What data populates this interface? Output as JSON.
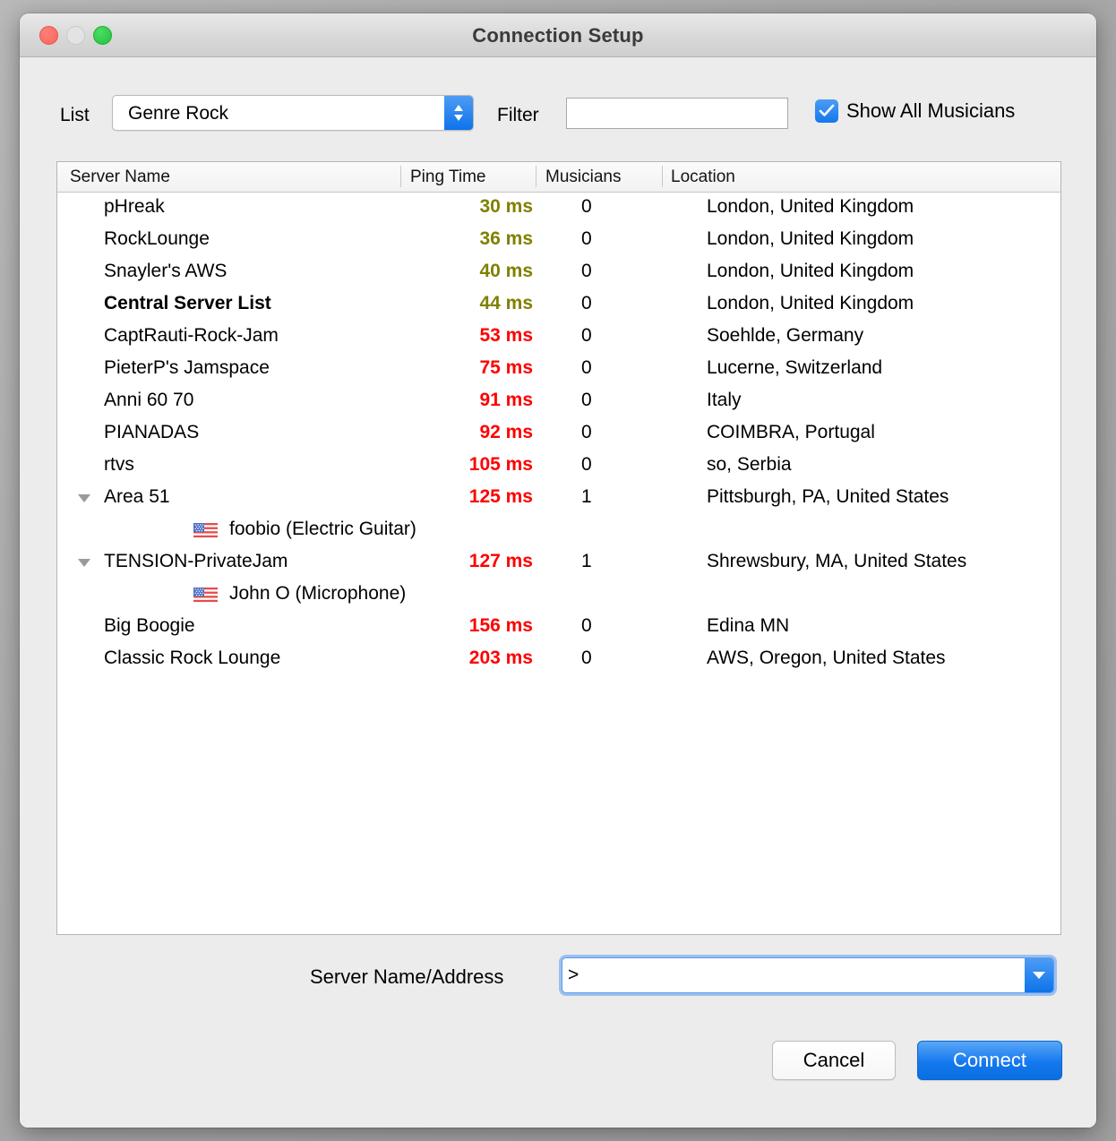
{
  "window": {
    "title": "Connection Setup",
    "traffic_lights": {
      "close": "close-button",
      "minimize": "minimize-button",
      "zoom": "zoom-button"
    }
  },
  "toolbar": {
    "list_label": "List",
    "list_value": "Genre Rock",
    "list_options": [
      "Genre Rock"
    ],
    "filter_label": "Filter",
    "filter_value": "",
    "filter_placeholder": "",
    "show_all_label": "Show All Musicians",
    "show_all_checked": true
  },
  "table": {
    "columns": [
      "Server Name",
      "Ping Time",
      "Musicians",
      "Location"
    ],
    "rows": [
      {
        "type": "server",
        "name": "pHreak",
        "ping": "30 ms",
        "ping_class": "olive",
        "musicians": "0",
        "location": "London, United Kingdom",
        "bold": false,
        "expandable": false
      },
      {
        "type": "server",
        "name": "RockLounge",
        "ping": "36 ms",
        "ping_class": "olive",
        "musicians": "0",
        "location": "London, United Kingdom",
        "bold": false,
        "expandable": false
      },
      {
        "type": "server",
        "name": "Snayler's AWS",
        "ping": "40 ms",
        "ping_class": "olive",
        "musicians": "0",
        "location": "London, United Kingdom",
        "bold": false,
        "expandable": false
      },
      {
        "type": "server",
        "name": "Central Server List",
        "ping": "44 ms",
        "ping_class": "olive",
        "musicians": "0",
        "location": "London, United Kingdom",
        "bold": true,
        "expandable": false
      },
      {
        "type": "server",
        "name": "CaptRauti-Rock-Jam",
        "ping": "53 ms",
        "ping_class": "red",
        "musicians": "0",
        "location": "Soehlde, Germany",
        "bold": false,
        "expandable": false
      },
      {
        "type": "server",
        "name": "PieterP's Jamspace",
        "ping": "75 ms",
        "ping_class": "red",
        "musicians": "0",
        "location": "Lucerne, Switzerland",
        "bold": false,
        "expandable": false
      },
      {
        "type": "server",
        "name": "Anni 60 70",
        "ping": "91 ms",
        "ping_class": "red",
        "musicians": "0",
        "location": "Italy",
        "bold": false,
        "expandable": false
      },
      {
        "type": "server",
        "name": "PIANADAS",
        "ping": "92 ms",
        "ping_class": "red",
        "musicians": "0",
        "location": "COIMBRA, Portugal",
        "bold": false,
        "expandable": false
      },
      {
        "type": "server",
        "name": "rtvs",
        "ping": "105 ms",
        "ping_class": "red",
        "musicians": "0",
        "location": "so, Serbia",
        "bold": false,
        "expandable": false
      },
      {
        "type": "server",
        "name": "Area 51",
        "ping": "125 ms",
        "ping_class": "red",
        "musicians": "1",
        "location": "Pittsburgh, PA, United States",
        "bold": false,
        "expandable": true
      },
      {
        "type": "musician",
        "name": "foobio (Electric Guitar)",
        "flag": "us-flag-icon"
      },
      {
        "type": "server",
        "name": "TENSION-PrivateJam",
        "ping": "127 ms",
        "ping_class": "red",
        "musicians": "1",
        "location": "Shrewsbury, MA, United States",
        "bold": false,
        "expandable": true
      },
      {
        "type": "musician",
        "name": "John O (Microphone)",
        "flag": "us-flag-icon"
      },
      {
        "type": "server",
        "name": "Big Boogie",
        "ping": "156 ms",
        "ping_class": "red",
        "musicians": "0",
        "location": "Edina MN",
        "bold": false,
        "expandable": false
      },
      {
        "type": "server",
        "name": "Classic Rock Lounge",
        "ping": "203 ms",
        "ping_class": "red",
        "musicians": "0",
        "location": "AWS, Oregon, United States",
        "bold": false,
        "expandable": false
      }
    ]
  },
  "address": {
    "label": "Server Name/Address",
    "value": ">",
    "placeholder": ""
  },
  "footer": {
    "cancel_label": "Cancel",
    "connect_label": "Connect"
  },
  "colors": {
    "ping_olive": "#808000",
    "ping_red": "#ff0000",
    "accent_blue": "#1479ee",
    "window_bg": "#ececec"
  }
}
